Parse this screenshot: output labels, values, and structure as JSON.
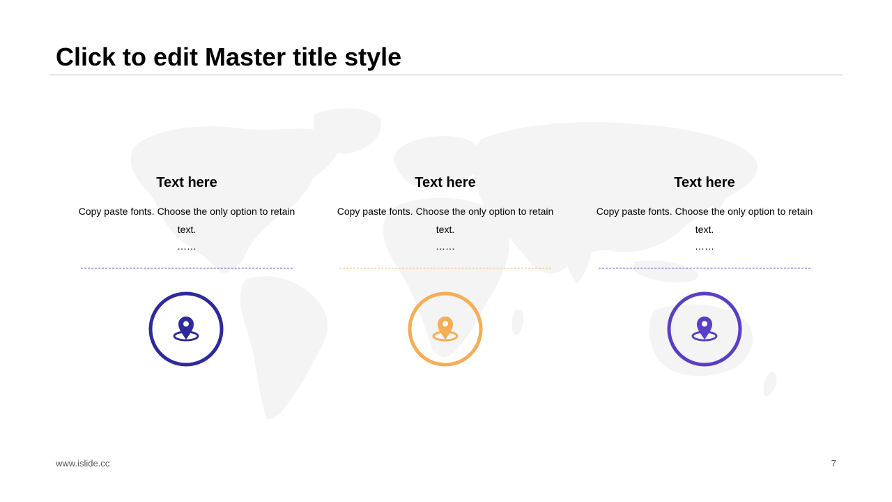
{
  "slide": {
    "title": "Click to edit Master title style",
    "footer_url": "www.islide.cc",
    "page_number": "7"
  },
  "columns": [
    {
      "heading": "Text here",
      "body": "Copy paste fonts. Choose the only option to retain text.",
      "dots": "……",
      "icon": "location-pin-icon",
      "color": "#2e2a9e"
    },
    {
      "heading": "Text here",
      "body": "Copy paste fonts. Choose the only option to retain text.",
      "dots": "……",
      "icon": "location-pin-icon",
      "color": "#f5ad56"
    },
    {
      "heading": "Text here",
      "body": "Copy paste fonts. Choose the only option to retain text.",
      "dots": "……",
      "icon": "location-pin-icon",
      "color": "#5b3ec8"
    }
  ],
  "colors": {
    "background": "#ffffff",
    "map": "#f4f4f4",
    "rule": "#bfbfbf"
  }
}
